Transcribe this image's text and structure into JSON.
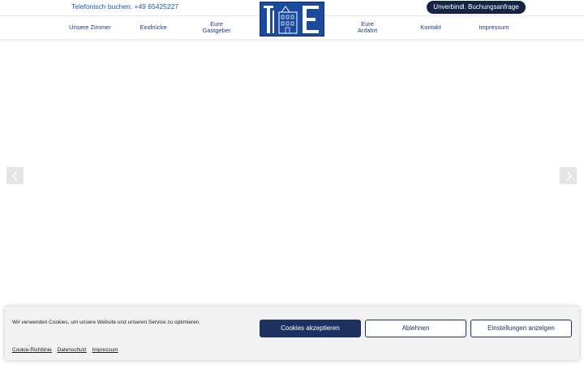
{
  "topbar": {
    "phone_text": "Telefonisch buchen: +49 65425227",
    "booking_button": "Unverbindl. Buchungsanfrage"
  },
  "nav": {
    "items": [
      {
        "label": "Unsere Zimmer"
      },
      {
        "label": "Eindrücke"
      },
      {
        "line1": "Eure",
        "line2": "Gastgeber"
      },
      {
        "line1": "Eure",
        "line2": "Anfahrt"
      },
      {
        "label": "Kontakt"
      },
      {
        "label": "Impressum"
      }
    ]
  },
  "logo": {
    "icon": "hotel-logo-te-icon",
    "colors": {
      "background": "#1a4b9e",
      "letters": "#ffffff"
    }
  },
  "slider": {
    "prev_icon": "chevron-left-icon",
    "next_icon": "chevron-right-icon"
  },
  "cookie": {
    "text": "Wir verwenden Cookies, um unsere Website und unseren Service zu optimieren.",
    "accept": "Cookies akzeptieren",
    "decline": "Ablehnen",
    "settings": "Einstellungen anzeigen",
    "links": [
      "Cookie-Richtlinie",
      "Datenschutz",
      "Impressum"
    ]
  },
  "colors": {
    "brand_dark": "#142346",
    "brand_blue": "#1a4b9e",
    "accent_button": "#1e3261"
  }
}
